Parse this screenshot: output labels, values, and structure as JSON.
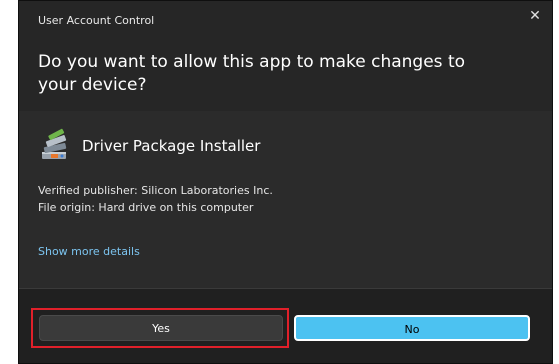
{
  "dialog": {
    "window_title": "User Account Control",
    "close_glyph": "✕",
    "question": "Do you want to allow this app to make changes to your device?",
    "app_name": "Driver Package Installer",
    "app_icon": "installer-package-icon",
    "publisher_line": "Verified publisher: Silicon Laboratories Inc.",
    "origin_line": "File origin: Hard drive on this computer",
    "more_details_link": "Show more details",
    "link_color": "#7cc4ef"
  },
  "buttons": {
    "yes_label": "Yes",
    "no_label": "No",
    "no_color": "#4cc2f1",
    "highlight_color": "#e0202a"
  }
}
